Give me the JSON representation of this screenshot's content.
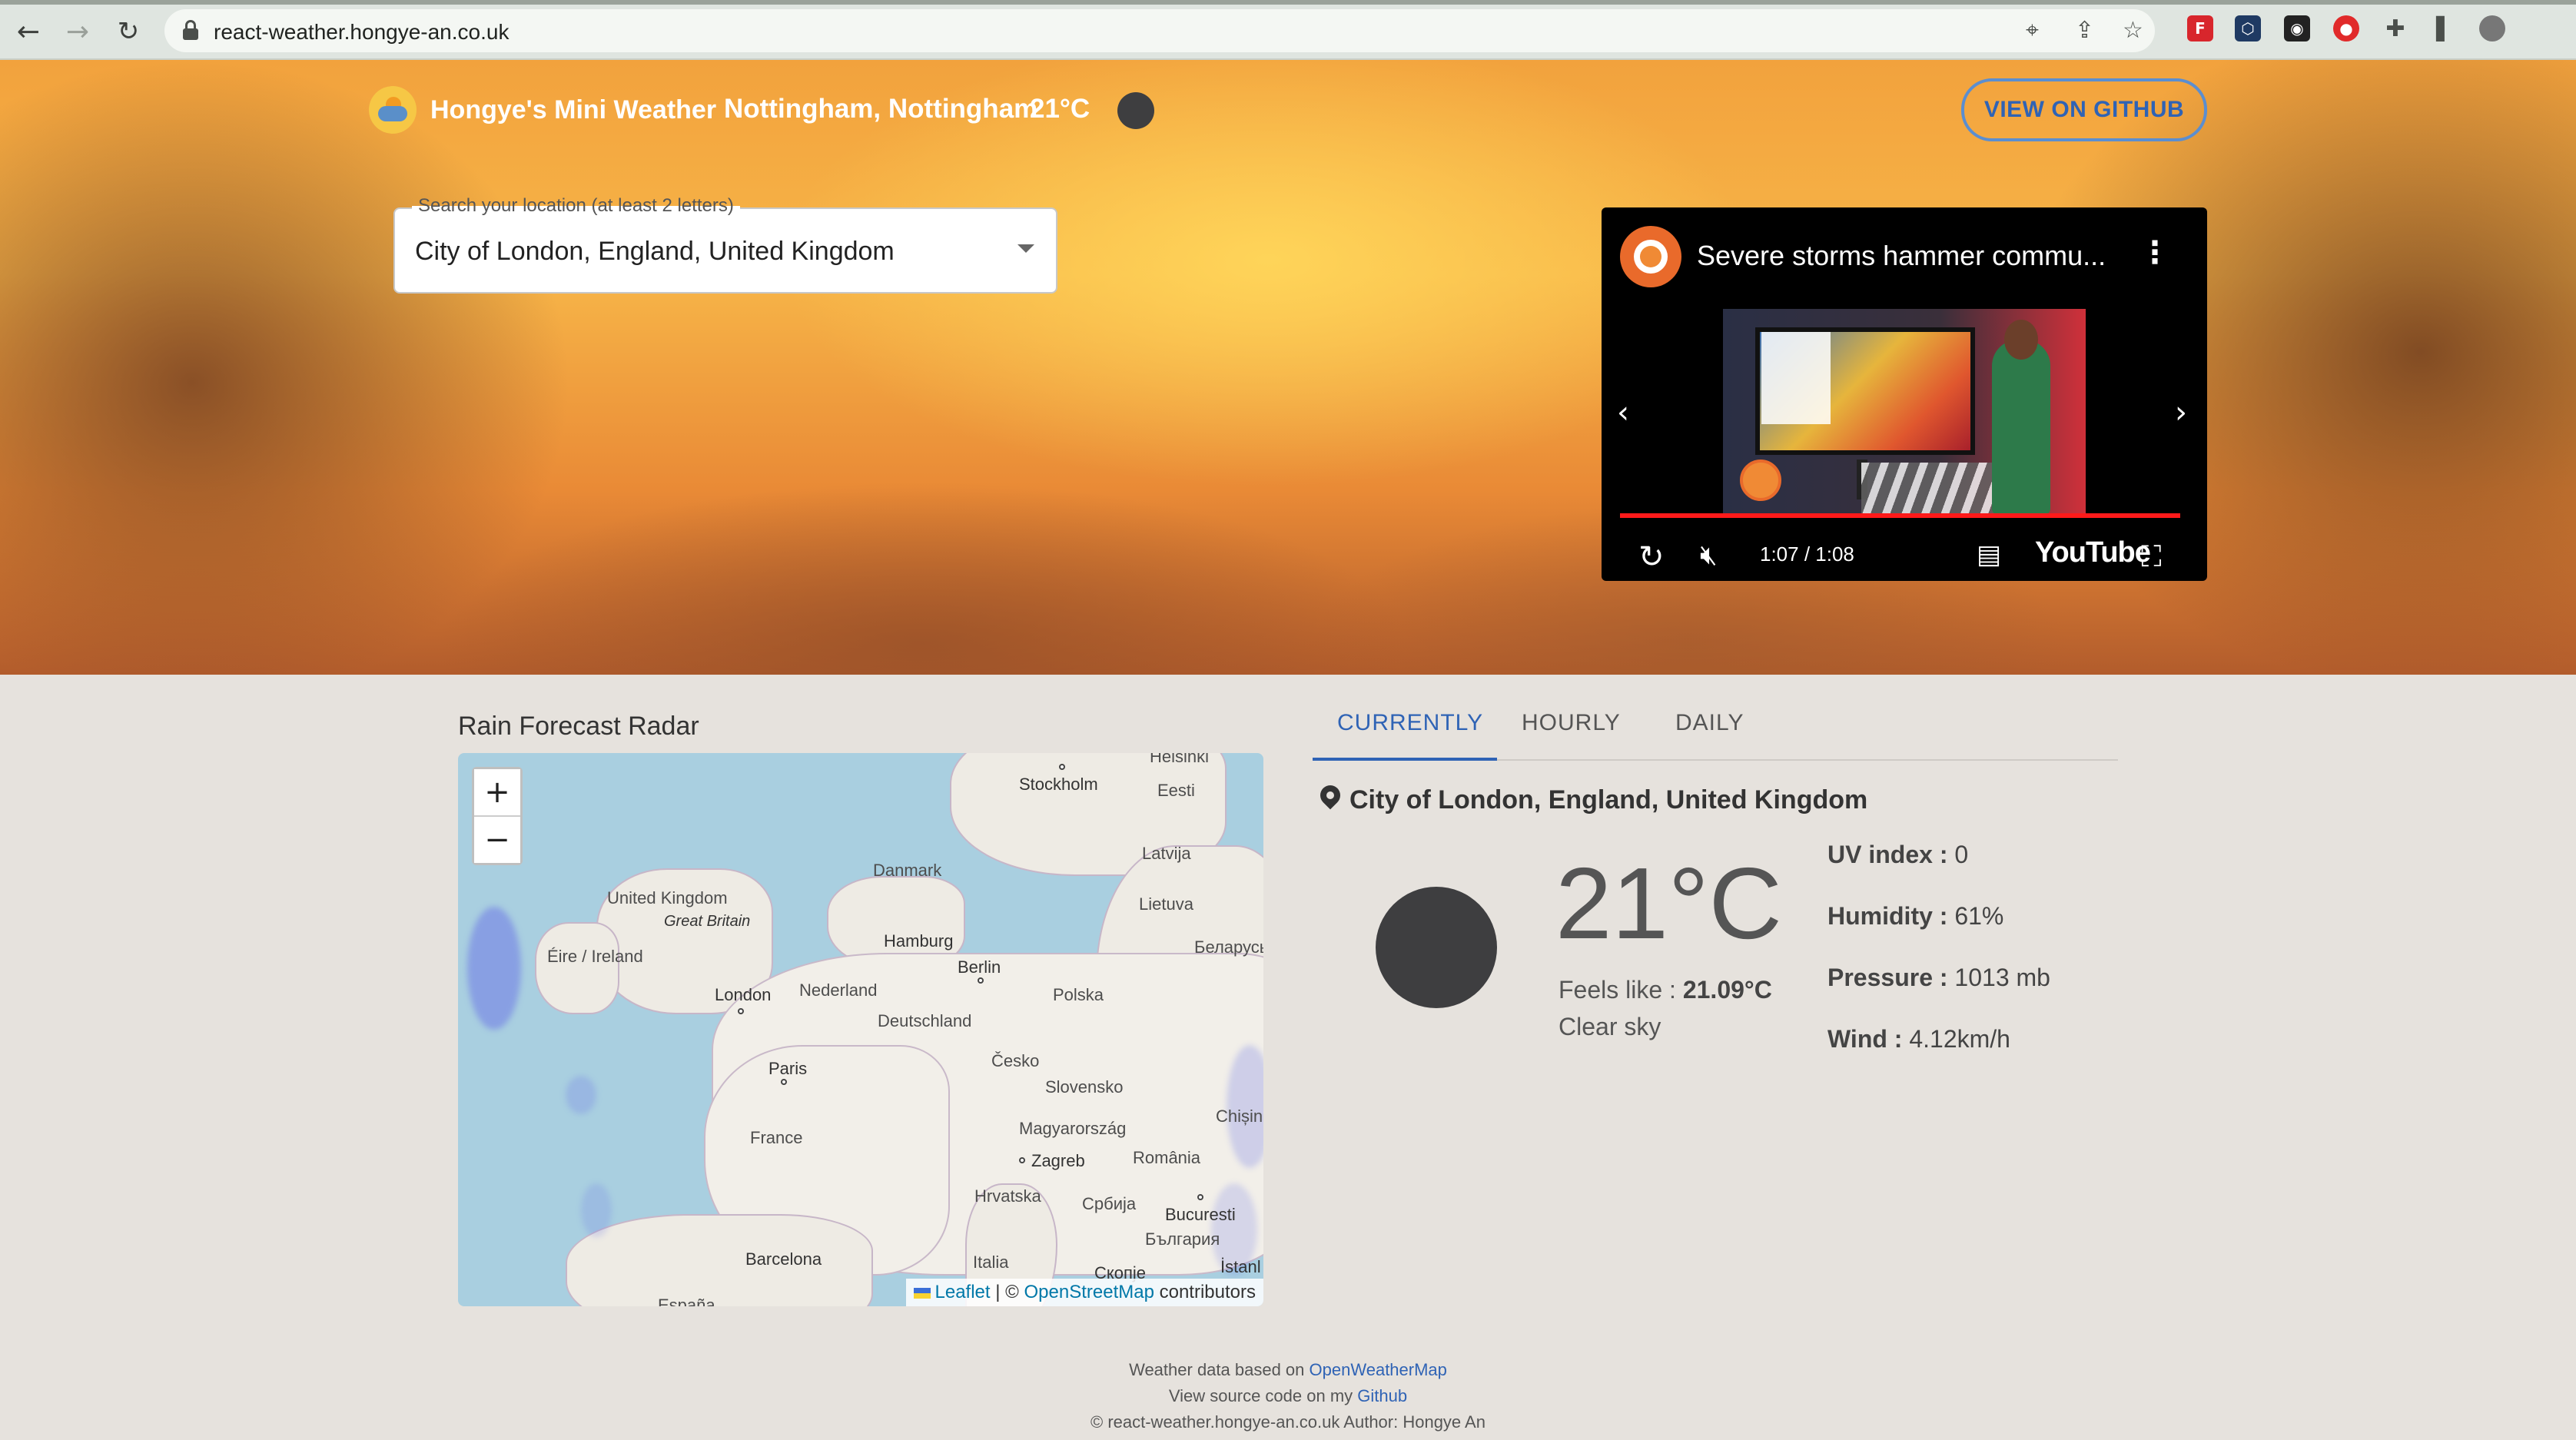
{
  "browser": {
    "url": "react-weather.hongye-an.co.uk"
  },
  "header": {
    "brand": "Hongye's Mini Weather",
    "location": "Nottingham, Nottingham",
    "temperature": "21°C",
    "github_button": "VIEW ON GITHUB"
  },
  "search": {
    "label": "Search your location (at least 2 letters)",
    "value": "City of London, England, United Kingdom"
  },
  "video": {
    "title": "Severe storms hammer commu...",
    "time": "1:07 / 1:08",
    "platform": "YouTube",
    "progress": 0.985
  },
  "radar": {
    "title": "Rain Forecast Radar",
    "zoom_in": "+",
    "zoom_out": "−",
    "labels": {
      "helsinki": "Helsinki",
      "stockholm": "Stockholm",
      "eesti": "Eesti",
      "latvija": "Latvija",
      "danmark": "Danmark",
      "lietuva": "Lietuva",
      "united_kingdom": "United Kingdom",
      "great_britain": "Great Britain",
      "hamburg": "Hamburg",
      "belarus": "Беларусь",
      "eire": "Éire / Ireland",
      "berlin": "Berlin",
      "london": "London",
      "nederland": "Nederland",
      "polska": "Polska",
      "deutschland": "Deutschland",
      "cesko": "Česko",
      "paris": "Paris",
      "slovensko": "Slovensko",
      "chisinau": "Chișin",
      "france": "France",
      "magyarorszag": "Magyarország",
      "zagreb": "Zagreb",
      "romania": "România",
      "hrvatska": "Hrvatska",
      "srbija": "Србија",
      "bucuresti": "Bucuresti",
      "bulgaria": "България",
      "barcelona": "Barcelona",
      "italia": "Italia",
      "skopje": "Скопје",
      "istanbul": "İstanl",
      "espana": "España"
    },
    "attribution": {
      "leaflet": "Leaflet",
      "separator": "| ©",
      "osm": "OpenStreetMap",
      "contributors": "contributors"
    }
  },
  "tabs": [
    "CURRENTLY",
    "HOURLY",
    "DAILY"
  ],
  "current": {
    "location": "City of London, England, United Kingdom",
    "temperature": "21°C",
    "feels_like_label": "Feels like :",
    "feels_like_value": "21.09°C",
    "description": "Clear sky",
    "stats": [
      {
        "label": "UV index :",
        "value": "0"
      },
      {
        "label": "Humidity :",
        "value": "61%"
      },
      {
        "label": "Pressure :",
        "value": "1013 mb"
      },
      {
        "label": "Wind :",
        "value": "4.12km/h"
      }
    ]
  },
  "footer": {
    "line1_text": "Weather data based on",
    "line1_link": "OpenWeatherMap",
    "line2_text": "View source code on my",
    "line2_link": "Github",
    "line3": "© react-weather.hongye-an.co.uk Author: Hongye An"
  },
  "colors": {
    "accent": "#2f63b5",
    "background": "#e6e2dd",
    "youtube_red": "#ff1a1a"
  }
}
